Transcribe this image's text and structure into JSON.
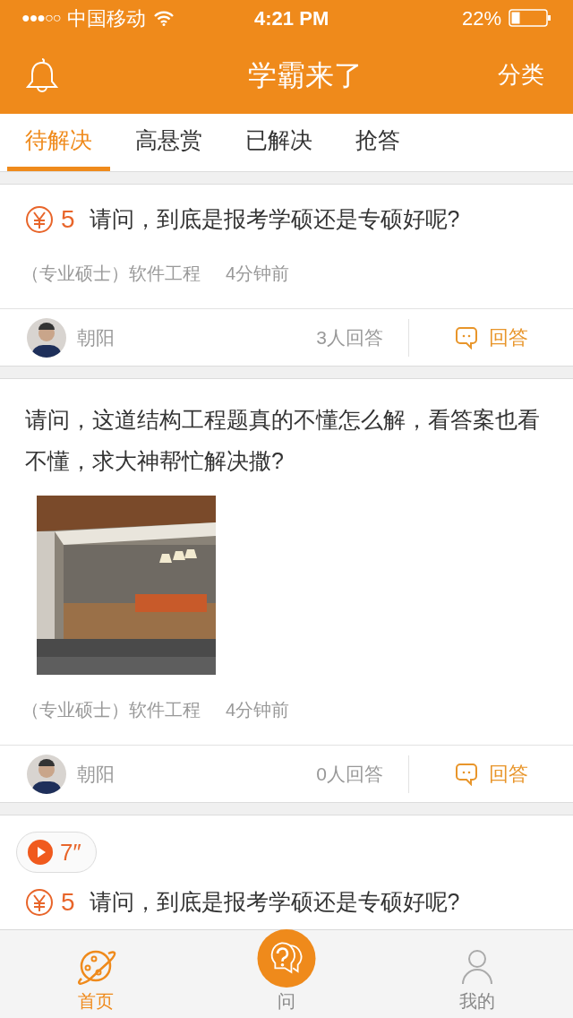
{
  "status_bar": {
    "signal": "●●●○○",
    "carrier": "中国移动",
    "time": "4:21 PM",
    "battery": "22%"
  },
  "header": {
    "title": "学霸来了",
    "action": "分类"
  },
  "tabs": [
    {
      "label": "待解决",
      "selected": true
    },
    {
      "label": "高悬赏",
      "selected": false
    },
    {
      "label": "已解决",
      "selected": false
    },
    {
      "label": "抢答",
      "selected": false
    }
  ],
  "cards": [
    {
      "reward": "5",
      "question": "请问，到底是报考学硕还是专硕好呢?",
      "category": "（专业硕士）软件工程",
      "time": "4分钟前",
      "user": "朝阳",
      "answers": "3人回答",
      "answer_button": "回答"
    },
    {
      "question": "请问，这道结构工程题真的不懂怎么解，看答案也看不懂，求大神帮忙解决撒?",
      "category": "（专业硕士）软件工程",
      "time": "4分钟前",
      "user": "朝阳",
      "answers": "0人回答",
      "answer_button": "回答"
    },
    {
      "voice": "7″",
      "reward": "5",
      "question": "请问，到底是报考学硕还是专硕好呢?"
    }
  ],
  "tab_bar": [
    {
      "label": "首页",
      "selected": true
    },
    {
      "label": "问",
      "selected": false
    },
    {
      "label": "我的",
      "selected": false
    }
  ]
}
